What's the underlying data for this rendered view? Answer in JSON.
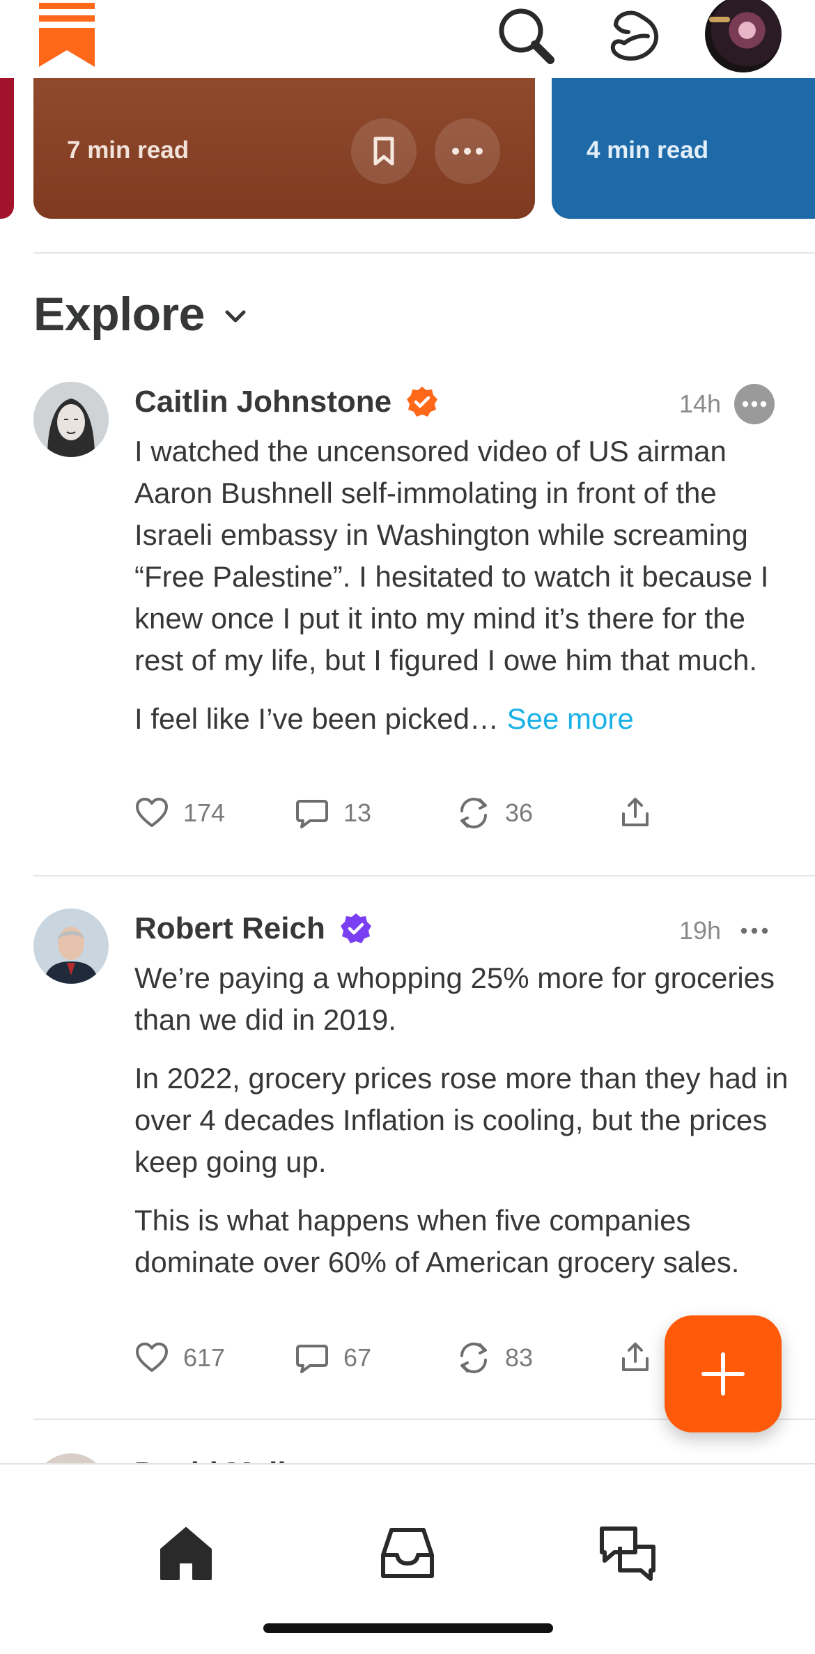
{
  "app": {
    "brand_color": "#ff6719",
    "name_icon": "bookmark-logo-icon"
  },
  "header": {
    "icons": [
      "search-icon",
      "activity-icon"
    ]
  },
  "carousel": {
    "cards": [
      {
        "read_time": "7 min read",
        "color": "#8a4329"
      },
      {
        "read_time": "4 min read",
        "color": "#1e6aa8"
      }
    ]
  },
  "explore": {
    "title": "Explore"
  },
  "posts": [
    {
      "author": "Caitlin Johnstone",
      "verified_color": "#ff6719",
      "time": "14h",
      "paragraphs": [
        "I watched the uncensored video of US airman Aaron Bushnell self-immolating in front of the Israeli embassy in Washington while screaming “Free Palestine”. I hesitated to watch it because I knew once I put it into my mind it’s there for the rest of my life, but I figured I owe him that much.",
        "I feel like I’ve been picked…"
      ],
      "see_more": "See more",
      "likes": "174",
      "comments": "13",
      "restacks": "36"
    },
    {
      "author": "Robert Reich",
      "verified_color": "#7a3ff2",
      "time": "19h",
      "paragraphs": [
        "We’re paying a whopping 25% more for groceries than we did in 2019.",
        "In 2022, grocery prices rose more than they had in over 4 decades Inflation is cooling, but the prices keep going up.",
        "This is what happens when five companies dominate over 60% of American grocery sales."
      ],
      "likes": "617",
      "comments": "67",
      "restacks": "83"
    }
  ],
  "peek": {
    "author_partial": "David Mell"
  },
  "fab": {
    "color": "#ff5a0a"
  },
  "tabbar": {
    "items": [
      "home-icon",
      "inbox-icon",
      "chat-icon"
    ]
  }
}
